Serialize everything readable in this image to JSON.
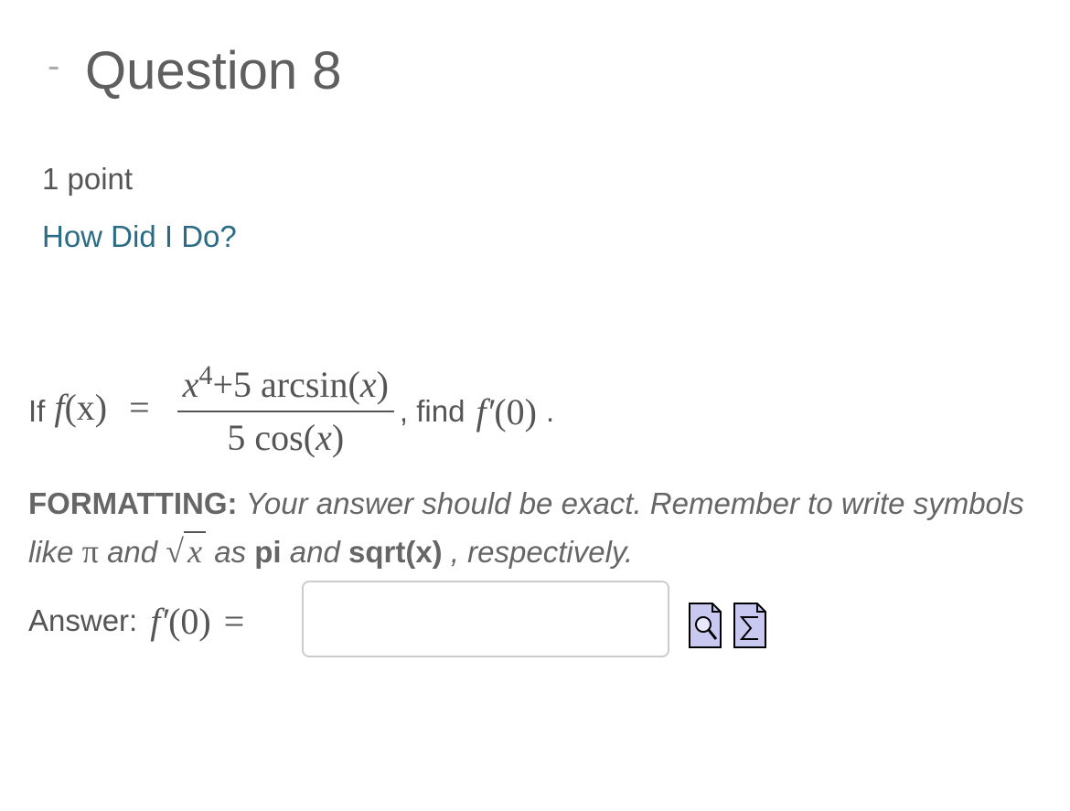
{
  "header": {
    "toggle": "-",
    "title": "Question 8"
  },
  "points": "1 point",
  "help_link": "How Did I Do?",
  "problem": {
    "prefix": "If",
    "lhs_fn": "f",
    "lhs_arg": "(x)",
    "eq": "=",
    "numerator_base": "x",
    "numerator_exp": "4",
    "numerator_rest": "+5 arcsin(",
    "numerator_var": "x",
    "numerator_close": ")",
    "denominator_coef": "5 cos(",
    "denominator_var": "x",
    "denominator_close": ")",
    "mid": ", find",
    "target_fn": "f′",
    "target_arg": "(0)",
    "suffix": "."
  },
  "formatting": {
    "label": "FORMATTING:",
    "text1": "Your answer should be exact. Remember to write symbols like",
    "pi_symbol": "π",
    "and1": "and",
    "sqrt_symbol": "√",
    "sqrt_var": "x",
    "as": "as",
    "pi_word": "pi",
    "and2": "and",
    "sqrt_word": "sqrt(x)",
    "end": ", respectively."
  },
  "answer": {
    "label": "Answer:",
    "fn": "f′",
    "arg": "(0)",
    "eq": "=",
    "value": "",
    "placeholder": ""
  },
  "icons": {
    "preview": "preview-magnifier-icon",
    "equation": "equation-editor-sigma-icon"
  },
  "colors": {
    "link": "#2b6b85",
    "text": "#555555",
    "icon_fill": "#c8c8f0"
  }
}
